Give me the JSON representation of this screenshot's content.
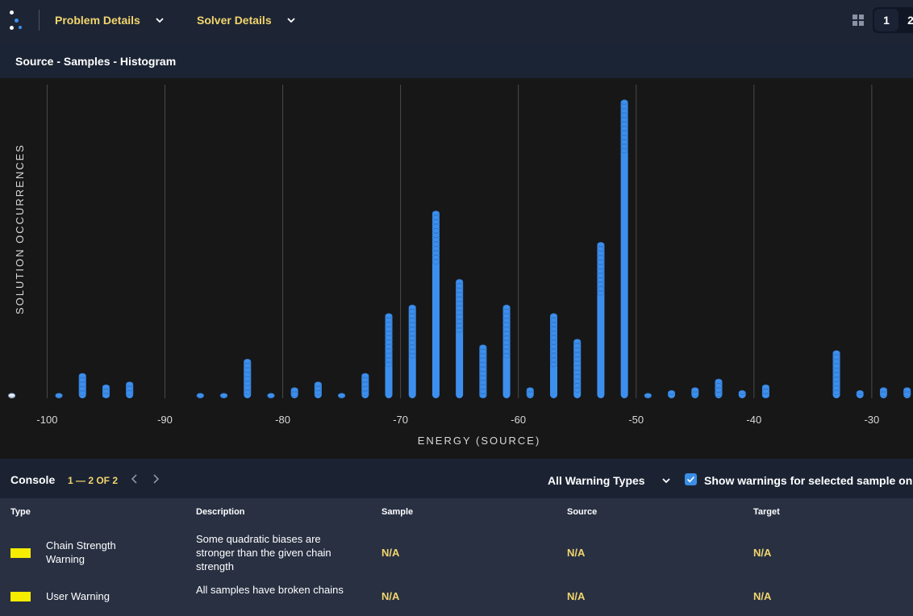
{
  "topbar": {
    "menus": [
      {
        "label": "Problem Details"
      },
      {
        "label": "Solver Details"
      }
    ],
    "pages": [
      "1",
      "2"
    ]
  },
  "chart_panel": {
    "title": "Source - Samples - Histogram"
  },
  "chart_data": {
    "type": "scatter",
    "xlabel": "ENERGY (SOURCE)",
    "ylabel": "SOLUTION OCCURRENCES",
    "xlim": [
      -104,
      -26.5
    ],
    "ylim": [
      0,
      105
    ],
    "xticks": [
      -100,
      -90,
      -80,
      -70,
      -60,
      -50,
      -40,
      -30
    ],
    "xtick_labels": [
      "-100",
      "-90",
      "-80",
      "-70",
      "-60",
      "-50",
      "-40",
      "-30"
    ],
    "grid": "vertical",
    "series": [
      {
        "color": "#3d8fed",
        "highlight_color": "#e8e8e8",
        "highlight_energy": -103,
        "points": [
          {
            "energy": -103,
            "count": 1
          },
          {
            "energy": -99,
            "count": 1
          },
          {
            "energy": -97,
            "count": 8
          },
          {
            "energy": -95,
            "count": 4
          },
          {
            "energy": -93,
            "count": 5
          },
          {
            "energy": -87,
            "count": 1
          },
          {
            "energy": -85,
            "count": 1
          },
          {
            "energy": -83,
            "count": 13
          },
          {
            "energy": -81,
            "count": 1
          },
          {
            "energy": -79,
            "count": 3
          },
          {
            "energy": -77,
            "count": 5
          },
          {
            "energy": -75,
            "count": 1
          },
          {
            "energy": -73,
            "count": 8
          },
          {
            "energy": -71,
            "count": 29
          },
          {
            "energy": -69,
            "count": 32
          },
          {
            "energy": -67,
            "count": 65
          },
          {
            "energy": -65,
            "count": 41
          },
          {
            "energy": -63,
            "count": 18
          },
          {
            "energy": -61,
            "count": 32
          },
          {
            "energy": -59,
            "count": 3
          },
          {
            "energy": -57,
            "count": 29
          },
          {
            "energy": -55,
            "count": 20
          },
          {
            "energy": -53,
            "count": 54
          },
          {
            "energy": -51,
            "count": 104
          },
          {
            "energy": -49,
            "count": 1
          },
          {
            "energy": -47,
            "count": 2
          },
          {
            "energy": -45,
            "count": 3
          },
          {
            "energy": -43,
            "count": 6
          },
          {
            "energy": -41,
            "count": 2
          },
          {
            "energy": -39,
            "count": 4
          },
          {
            "energy": -33,
            "count": 16
          },
          {
            "energy": -31,
            "count": 2
          },
          {
            "energy": -29,
            "count": 3
          },
          {
            "energy": -27,
            "count": 3
          }
        ]
      }
    ]
  },
  "console": {
    "title": "Console",
    "count": "1 — 2 OF 2",
    "warning_filter": "All Warning Types",
    "checkbox_label": "Show warnings for selected sample only",
    "checkbox_checked": true,
    "columns": [
      "Type",
      "Description",
      "Sample",
      "Source",
      "Target"
    ],
    "rows": [
      {
        "type": "Chain Strength Warning",
        "type_color": "#f5ec00",
        "description": "Some quadratic biases are stronger than the given chain strength",
        "sample": "N/A",
        "source": "N/A",
        "target": "N/A"
      },
      {
        "type": "User Warning",
        "type_color": "#f5ec00",
        "description": "All samples have broken chains",
        "sample": "N/A",
        "source": "N/A",
        "target": "N/A"
      }
    ]
  }
}
